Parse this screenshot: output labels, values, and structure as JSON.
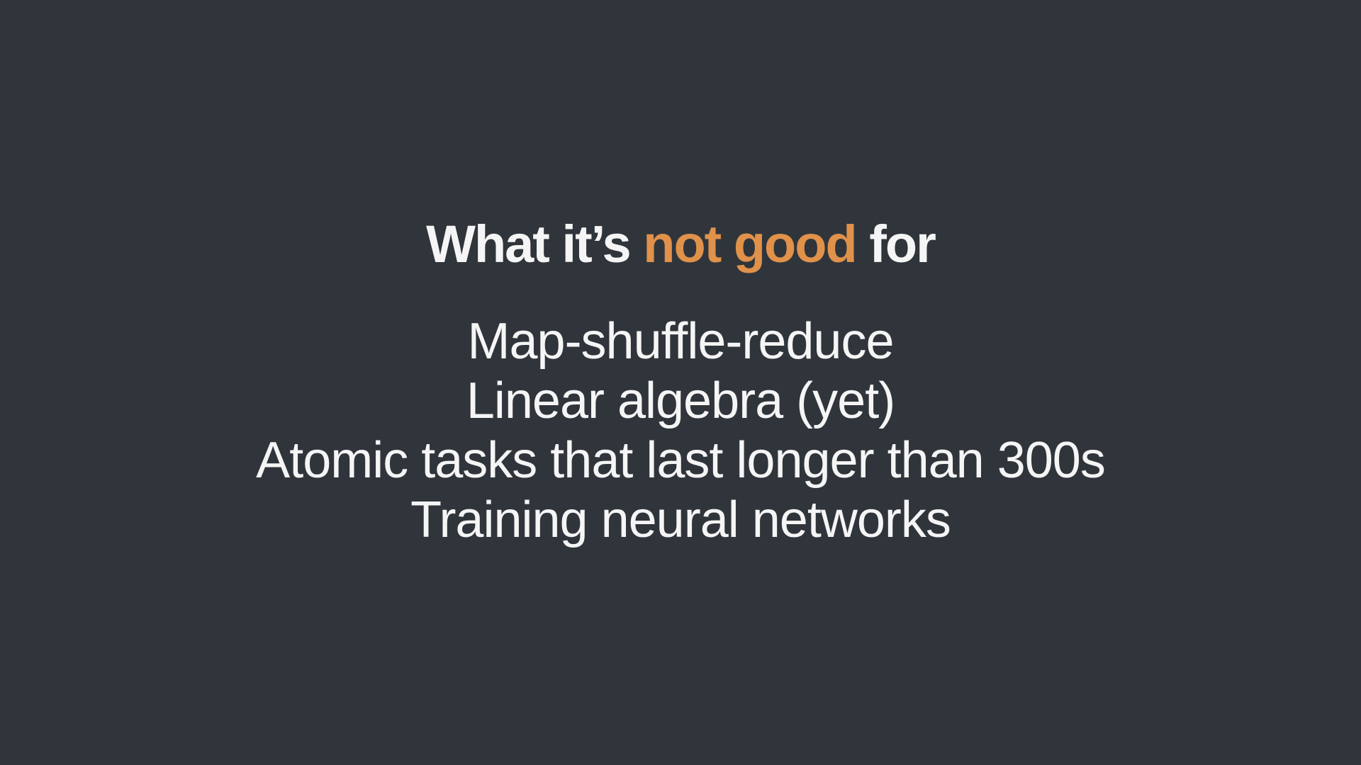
{
  "slide": {
    "title": {
      "before": "What it’s ",
      "highlight": "not good",
      "after": " for"
    },
    "items": [
      "Map-shuffle-reduce",
      "Linear algebra (yet)",
      "Atomic tasks that last longer than 300s",
      "Training neural networks"
    ],
    "colors": {
      "background": "#30353b",
      "text": "#f5f5f5",
      "accent": "#e0914a"
    }
  }
}
